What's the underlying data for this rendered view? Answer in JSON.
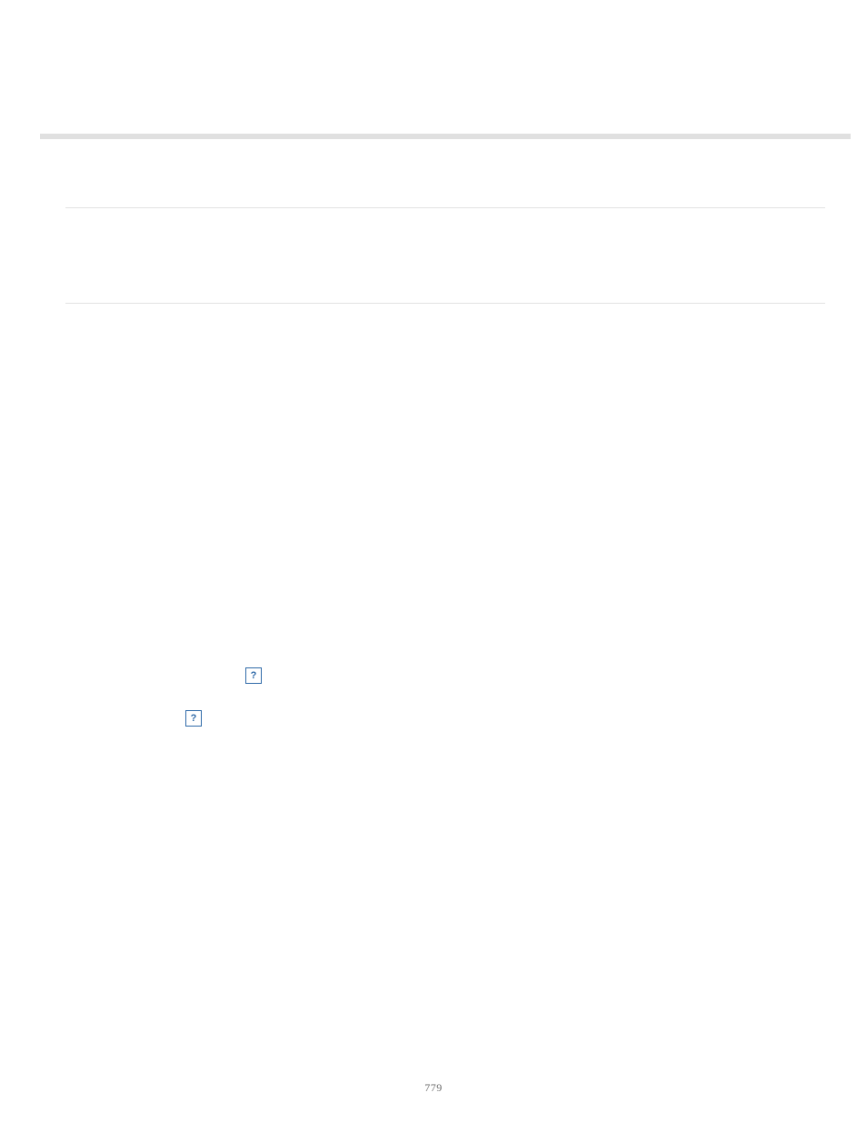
{
  "topbar": {
    "color": "#e0e0e0"
  },
  "rules": {
    "upper": true,
    "lower": true
  },
  "placeholders": {
    "icon1_name": "missing-image-icon",
    "icon2_name": "missing-image-icon"
  },
  "page_number": "779"
}
